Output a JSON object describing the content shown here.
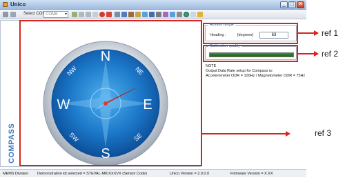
{
  "window": {
    "title": "Unico",
    "min_glyph": "_",
    "max_glyph": "□",
    "close_glyph": "×"
  },
  "toolbar": {
    "com_label": "Select COM:",
    "com_value": "COM6",
    "com_arrow": "▾"
  },
  "compass": {
    "panel_label": "COMPASS",
    "cardinals": {
      "n": "N",
      "e": "E",
      "s": "S",
      "w": "W"
    },
    "intercardinals": {
      "ne": "NE",
      "se": "SE",
      "sw": "SW",
      "nw": "NW"
    },
    "needle_heading_deg": 63
  },
  "azimuth": {
    "title": "Azimuth angle",
    "heading_label": "Heading :",
    "unit": "[degrees]",
    "value": "63"
  },
  "calibration": {
    "title": "Calibration quality",
    "level": 1.0,
    "color": "#2a7a2a"
  },
  "note": {
    "title": "NOTE",
    "line1": "Output Data Rate setup for Compass is:",
    "line2": "Accelerometer ODR = 100Hz / Magnetometer ODR = 75Hz"
  },
  "status": {
    "division": "MEMS Division",
    "kit": "Demonstration kit selected = STEVAL-MKIXXXVX (Sensor Code)",
    "unico_version": "Unico Version = 2.0.0.0",
    "firmware": "Firmware Version = X.XX"
  },
  "annotations": {
    "ref1": "ref 1",
    "ref2": "ref 2",
    "ref3": "ref 3",
    "color": "#d8241c"
  }
}
